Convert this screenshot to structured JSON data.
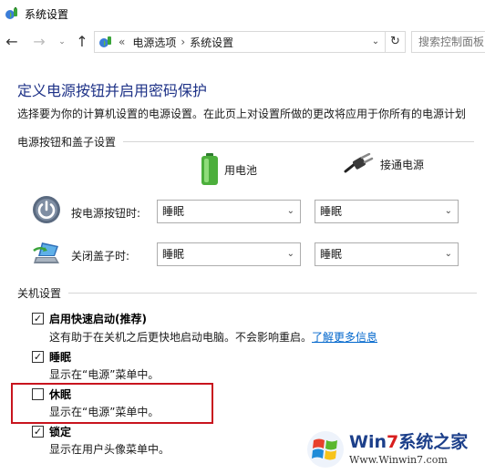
{
  "window": {
    "title": "系统设置"
  },
  "nav": {
    "back_glyph": "←",
    "forward_glyph": "→",
    "recent_glyph": "⌄",
    "up_glyph": "↑",
    "address": {
      "overflow": "«",
      "crumbs": [
        "电源选项",
        "系统设置"
      ],
      "separator": "›",
      "drop_glyph": "⌄",
      "refresh_glyph": "↻"
    },
    "search_placeholder": "搜索控制面板"
  },
  "page": {
    "title": "定义电源按钮并启用密码保护",
    "description": "选择要为你的计算机设置的电源设置。在此页上对设置所做的更改将应用于你所有的电源计划"
  },
  "power_section": {
    "heading": "电源按钮和盖子设置",
    "columns": {
      "battery": "用电池",
      "plugged": "接通电源"
    },
    "rows": [
      {
        "label": "按电源按钮时:",
        "battery": "睡眠",
        "plugged": "睡眠"
      },
      {
        "label": "关闭盖子时:",
        "battery": "睡眠",
        "plugged": "睡眠"
      }
    ],
    "chevron": "⌄"
  },
  "shutdown_section": {
    "heading": "关机设置",
    "check_glyph": "✓",
    "items": [
      {
        "label": "启用快速启动(推荐)",
        "checked": true,
        "desc": "这有助于在关机之后更快地启动电脑。不会影响重启。",
        "link": "了解更多信息"
      },
      {
        "label": "睡眠",
        "checked": true,
        "desc": "显示在“电源”菜单中。"
      },
      {
        "label": "休眠",
        "checked": false,
        "desc": "显示在“电源”菜单中。"
      },
      {
        "label": "锁定",
        "checked": true,
        "desc": "显示在用户头像菜单中。"
      }
    ]
  },
  "watermark": {
    "title_a": "Win",
    "title_num": "7",
    "title_b": "系统之家",
    "url": "Www.Winwin7.com"
  },
  "colors": {
    "title_blue": "#1e3287",
    "link_blue": "#0066cc",
    "highlight_red": "#c8141e",
    "battery_green": "#4caf3c"
  }
}
